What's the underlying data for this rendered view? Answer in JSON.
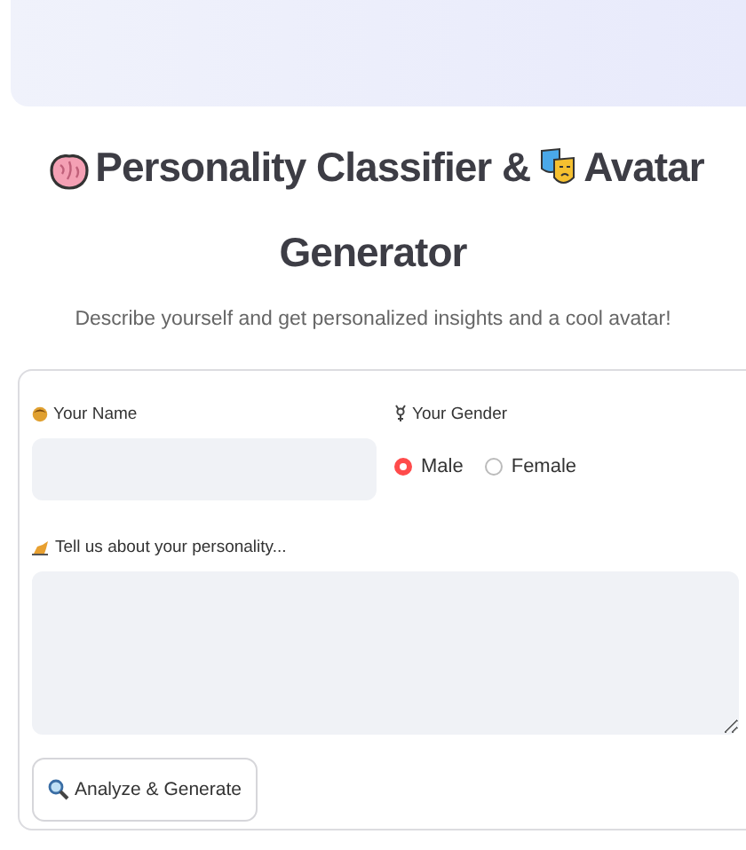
{
  "header": {
    "title_part_1": "Personality Classifier &",
    "title_part_2": "Avatar",
    "title_part_3": "Generator",
    "subtitle": "Describe yourself and get personalized insights and a cool avatar!"
  },
  "form": {
    "name_label": "Your Name",
    "gender_label": "Your Gender",
    "gender_options": [
      {
        "label": "Male",
        "selected": true
      },
      {
        "label": "Female",
        "selected": false
      }
    ],
    "personality_label": "Tell us about your personality...",
    "submit_button": "Analyze & Generate"
  }
}
